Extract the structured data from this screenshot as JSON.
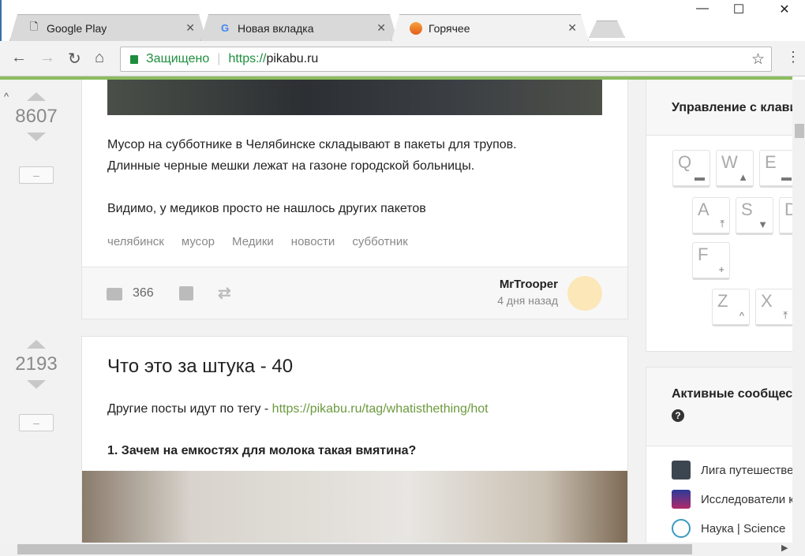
{
  "browser": {
    "tabs": [
      {
        "title": "Google Play",
        "icon": "page-icon"
      },
      {
        "title": "Новая вкладка",
        "icon": "google-icon"
      },
      {
        "title": "Горячее",
        "icon": "pikabu-icon",
        "active": true
      }
    ],
    "address": {
      "secure_label": "Защищено",
      "scheme": "https://",
      "host": "pikabu.ru"
    }
  },
  "post1": {
    "rating": "8607",
    "text_lines": [
      "Мусор на субботнике в Челябинске складывают в пакеты для трупов.",
      "Длинные черные мешки лежат на газоне городской больницы."
    ],
    "text2": "Видимо, у медиков просто не нашлось других пакетов",
    "tags": [
      "челябинск",
      "мусор",
      "Медики",
      "новости",
      "субботник"
    ],
    "comments": "366",
    "author": "MrTrooper",
    "time": "4 дня назад",
    "hide_label": "–"
  },
  "post2": {
    "rating": "2193",
    "title": "Что это за штука - 40",
    "intro": "Другие посты идут по тегу - ",
    "link": "https://pikabu.ru/tag/whatisthething/hot",
    "question": "1. Зачем на емкостях для молока такая вмятина?",
    "hide_label": "–"
  },
  "sidebar": {
    "keyboard_title": "Управление с клавиатуры",
    "keys": [
      {
        "k": "Q",
        "s": "▬"
      },
      {
        "k": "W",
        "s": "▲"
      },
      {
        "k": "E",
        "s": "▬"
      },
      {
        "k": "A",
        "s": "⤒"
      },
      {
        "k": "S",
        "s": "▼"
      },
      {
        "k": "D",
        "s": ""
      },
      {
        "k": "F",
        "s": "+"
      },
      {
        "k": "Z",
        "s": "^"
      },
      {
        "k": "X",
        "s": "⤒"
      }
    ],
    "communities_title": "Активные сообщества",
    "communities": [
      "Лига путешественников",
      "Исследователи космоса",
      "Наука | Science"
    ]
  }
}
